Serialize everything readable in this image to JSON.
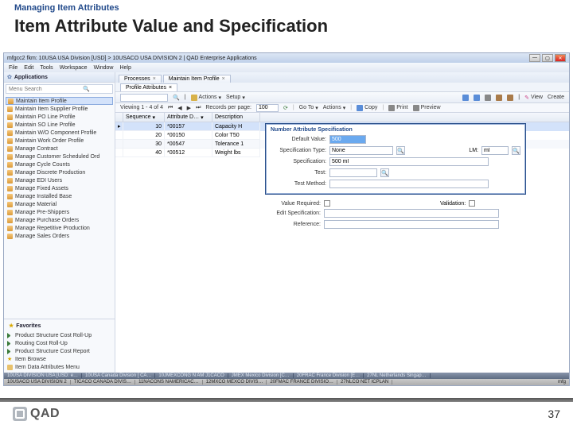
{
  "slide": {
    "subtitle": "Managing Item Attributes",
    "title": "Item Attribute Value and Specification",
    "page": "37",
    "logo": "QAD"
  },
  "window": {
    "title": "mfgcc2 fkm: 10USA USA Division [USD] > 10USACO USA DIVISION 2 | QAD Enterprise Applications",
    "menus": [
      "File",
      "Edit",
      "Tools",
      "Workspace",
      "Window",
      "Help"
    ],
    "winbtns": {
      "min": "—",
      "max": "▢",
      "close": "✕"
    }
  },
  "leftpane": {
    "header": "Applications",
    "search_placeholder": "Menu Search",
    "items": [
      "Maintain Item Profile",
      "Maintain Item Supplier Profile",
      "Maintain PO Line Profile",
      "Maintain SO Line Profile",
      "Maintain W/O Component Profile",
      "Maintain Work Order Profile",
      "Manage Contract",
      "Manage Customer Scheduled Ord",
      "Manage Cycle Counts",
      "Manage Discrete Production",
      "Manage EDI Users",
      "Manage Fixed Assets",
      "Manage Installed Base",
      "Manage Material",
      "Manage Pre-Shippers",
      "Manage Purchase Orders",
      "Manage Repetitive Production",
      "Manage Sales Orders"
    ],
    "favorites_header": "Favorites",
    "favorites": [
      "Product Structure Cost Roll-Up",
      "Routing Cost Roll-Up",
      "Product Structure Cost Report",
      "Item Browse",
      "Item Data Attributes Menu"
    ]
  },
  "tabs": {
    "items": [
      "Processes",
      "Maintain Item Profile"
    ],
    "sub": "Profile Attributes"
  },
  "toolbar": {
    "actions_label": "Actions",
    "setup_label": "Setup",
    "view_label": "View",
    "create_label": "Create",
    "search": ""
  },
  "recbar": {
    "viewing": "Viewing 1 - 4 of 4",
    "rpp_label": "Records per page:",
    "rpp_value": "100",
    "goto_label": "Go To",
    "actions_label": "Actions",
    "copy_label": "Copy",
    "print_label": "Print",
    "preview_label": "Preview"
  },
  "grid": {
    "headers": [
      "Sequence",
      "Attribute D…",
      "Description"
    ],
    "rows": [
      {
        "seq": "10",
        "addr": "*00157",
        "desc": "Capacity H"
      },
      {
        "seq": "20",
        "addr": "*00150",
        "desc": "Color T50"
      },
      {
        "seq": "30",
        "addr": "*00547",
        "desc": "Tolerance 1"
      },
      {
        "seq": "40",
        "addr": "*00512",
        "desc": "Weight lbs"
      }
    ]
  },
  "panel": {
    "title": "Number Attribute Specification",
    "default_lbl": "Default Value:",
    "default_val": "500",
    "spectype_lbl": "Specification Type:",
    "spectype_val": "None",
    "lm_lbl": "LM:",
    "lm_val": "ml",
    "spec_lbl": "Specification:",
    "spec_val": "500 ml",
    "test_lbl": "Test:",
    "test_val": "",
    "tm_lbl": "Test Method:",
    "tm_val": ""
  },
  "bottom": {
    "valreq_lbl": "Value Required:",
    "validation_lbl": "Validation:",
    "editspec_lbl": "Edit Specification:",
    "editspec_val": "",
    "reference_lbl": "Reference:",
    "reference_val": ""
  },
  "status": {
    "top": [
      "10USA DIVISION USA [USD: e…",
      "10USA Canada Division [ CA…",
      "10JMEXCONG N AM J1CACO",
      "JMEX Mexico Division [C…",
      "20FRAC France Division [E…",
      "27NL Netherlands Singap…"
    ],
    "bot": [
      "10USACO USA DIVISION 2",
      "TICACO CANADA DIVIS…",
      "11NACONS NAMERICAC…",
      "12MXCO MEXCO DIVIS…",
      "20FMAC FRANCE DIVISIO…",
      "27NLCO NET ICPLAN"
    ],
    "right": "mfg"
  }
}
